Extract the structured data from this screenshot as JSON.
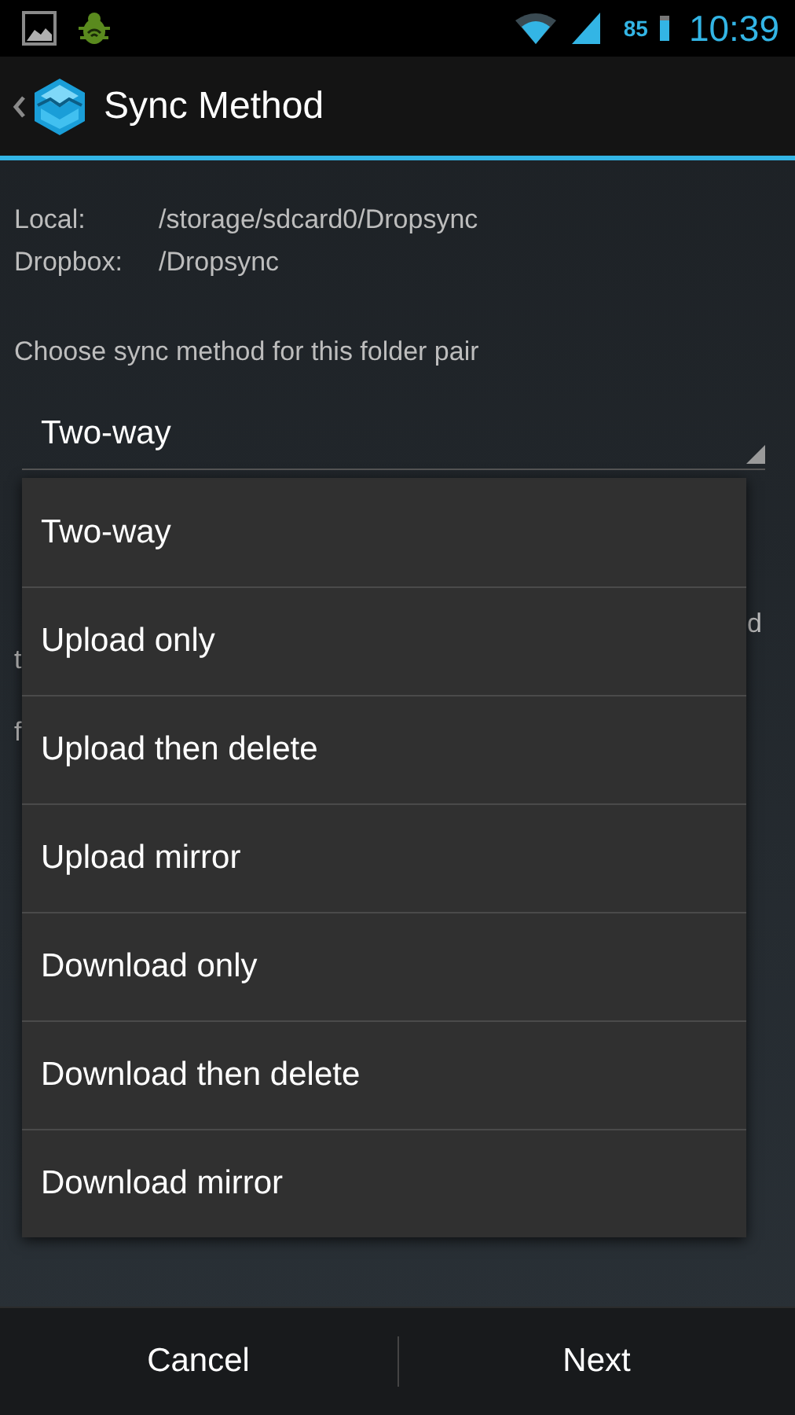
{
  "status_bar": {
    "battery": "85",
    "time": "10:39"
  },
  "action_bar": {
    "title": "Sync Method"
  },
  "folders": [
    {
      "label": "Local:",
      "path": "/storage/sdcard0/Dropsync"
    },
    {
      "label": "Dropbox:",
      "path": "/Dropsync"
    }
  ],
  "prompt": "Choose sync method for this folder pair",
  "spinner": {
    "value": "Two-way"
  },
  "hidden_text_fragments": [
    {
      "text": "d",
      "kind": "right"
    },
    {
      "text": "t",
      "kind": "left"
    },
    {
      "text": "f",
      "kind": "left"
    }
  ],
  "dropdown": {
    "options": [
      "Two-way",
      "Upload only",
      "Upload then delete",
      "Upload mirror",
      "Download only",
      "Download then delete",
      "Download mirror"
    ]
  },
  "buttons": [
    "Cancel",
    "Next"
  ]
}
